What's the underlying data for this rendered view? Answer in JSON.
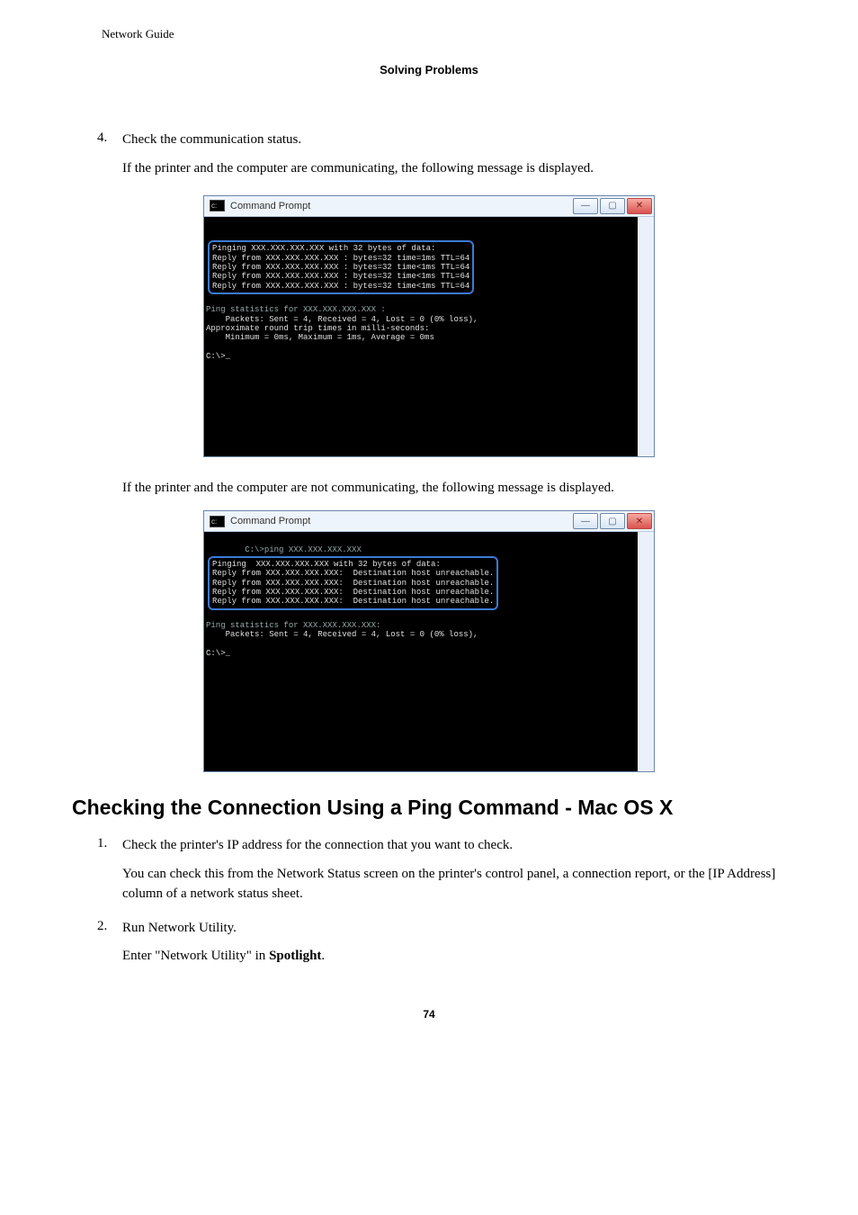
{
  "header": {
    "running": "Network Guide",
    "section": "Solving Problems"
  },
  "steps": {
    "s4": {
      "num": "4.",
      "text": "Check the communication status.",
      "sub1": "If the printer and the computer are communicating, the following message is displayed.",
      "sub2": "If the printer and the computer are not communicating, the following message is displayed."
    }
  },
  "cmd_window": {
    "title": "Command Prompt"
  },
  "terminal_ok": {
    "pre_line": "    ",
    "block1": "Pinging XXX.XXX.XXX.XXX with 32 bytes of data:\nReply from XXX.XXX.XXX.XXX : bytes=32 time=1ms TTL=64\nReply from XXX.XXX.XXX.XXX : bytes=32 time<1ms TTL=64\nReply from XXX.XXX.XXX.XXX : bytes=32 time<1ms TTL=64\nReply from XXX.XXX.XXX.XXX : bytes=32 time<1ms TTL=64",
    "stats_header": "Ping statistics for XXX.XXX.XXX.XXX :",
    "stats_body": "    Packets: Sent = 4, Received = 4, Lost = 0 (0% loss),\nApproximate round trip times in milli-seconds:\n    Minimum = 0ms, Maximum = 1ms, Average = 0ms",
    "prompt": "C:\\>_"
  },
  "terminal_fail": {
    "input_line": "C:\\>ping XXX.XXX.XXX.XXX",
    "block1": "Pinging  XXX.XXX.XXX.XXX with 32 bytes of data:\nReply from XXX.XXX.XXX.XXX:  Destination host unreachable.\nReply from XXX.XXX.XXX.XXX:  Destination host unreachable.\nReply from XXX.XXX.XXX.XXX:  Destination host unreachable.\nReply from XXX.XXX.XXX.XXX:  Destination host unreachable.",
    "stats_header": "Ping statistics for XXX.XXX.XXX.XXX:",
    "stats_body": "    Packets: Sent = 4, Received = 4, Lost = 0 (0% loss),",
    "prompt": "C:\\>_"
  },
  "macos": {
    "heading": "Checking the Connection Using a Ping Command - Mac OS X",
    "s1": {
      "num": "1.",
      "text": "Check the printer's IP address for the connection that you want to check.",
      "sub": "You can check this from the Network Status screen on the printer's control panel, a connection report, or the [IP Address] column of a network status sheet."
    },
    "s2": {
      "num": "2.",
      "text": "Run Network Utility.",
      "sub_prefix": "Enter \"Network Utility\" in ",
      "sub_bold": "Spotlight",
      "sub_suffix": "."
    }
  },
  "page_number": "74"
}
